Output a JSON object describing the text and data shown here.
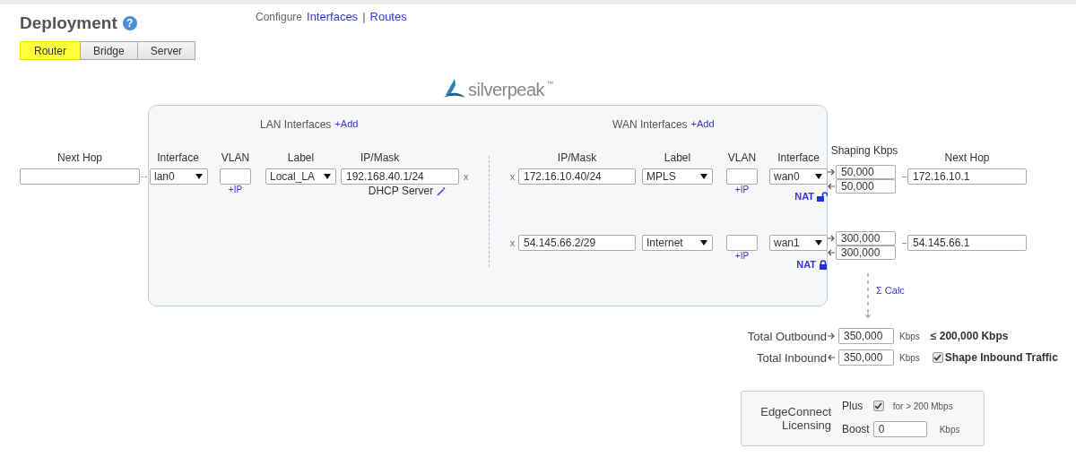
{
  "title": "Deployment",
  "help": "?",
  "nav": {
    "label": "Configure",
    "links": [
      "Interfaces",
      "Routes"
    ],
    "separator": "|"
  },
  "tabs": [
    {
      "label": "Router",
      "selected": true
    },
    {
      "label": "Bridge",
      "selected": false
    },
    {
      "label": "Server",
      "selected": false
    }
  ],
  "logo": {
    "text": "silverpeak",
    "mark": "™"
  },
  "lan": {
    "heading": "LAN Interfaces",
    "add": "+Add",
    "next_hop_heading": "Next Hop",
    "columns": [
      "Interface",
      "VLAN",
      "Label",
      "IP/Mask"
    ],
    "rows": [
      {
        "interface": "lan0",
        "add_ip": "+IP",
        "label": "Local_LA",
        "ip": "192.168.40.1/24",
        "remove": "x",
        "dhcp": "DHCP Server"
      }
    ]
  },
  "wan": {
    "heading": "WAN Interfaces",
    "add": "+Add",
    "columns": [
      "IP/Mask",
      "Label",
      "VLAN",
      "Interface"
    ],
    "shaping_heading": "Shaping Kbps",
    "next_hop_heading": "Next Hop",
    "rows": [
      {
        "remove": "x",
        "ip": "172.16.10.40/24",
        "label": "MPLS",
        "add_ip": "+IP",
        "interface": "wan0",
        "nat": "NAT",
        "nat_locked": false,
        "outbound": "50,000",
        "inbound": "50,000",
        "next_hop": "172.16.10.1"
      },
      {
        "remove": "x",
        "ip": "54.145.66.2/29",
        "label": "Internet",
        "add_ip": "+IP",
        "interface": "wan1",
        "nat": "NAT",
        "nat_locked": true,
        "outbound": "300,000",
        "inbound": "300,000",
        "next_hop": "54.145.66.1"
      }
    ]
  },
  "calc": "Σ Calc",
  "totals": {
    "outbound": {
      "label": "Total Outbound",
      "value": "350,000",
      "unit": "Kbps",
      "limit": "≤ 200,000 Kbps"
    },
    "inbound": {
      "label": "Total Inbound",
      "value": "350,000",
      "unit": "Kbps"
    },
    "shape_inbound": {
      "label": "Shape Inbound Traffic",
      "checked": true
    }
  },
  "licensing": {
    "title": "EdgeConnect Licensing",
    "plus": {
      "label": "Plus",
      "checked": true,
      "note": "for > 200 Mbps"
    },
    "boost": {
      "label": "Boost",
      "value": "0",
      "unit": "Kbps"
    }
  }
}
